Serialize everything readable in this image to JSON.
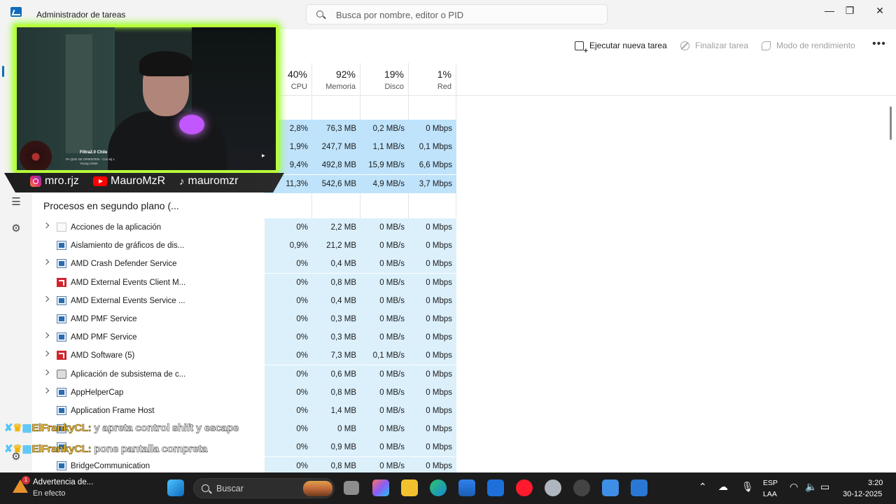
{
  "window": {
    "title": "Administrador de tareas",
    "search_placeholder": "Busca por nombre, editor o PID",
    "minimize": "—",
    "maximize": "❐",
    "close": "✕"
  },
  "commands": {
    "run_task": "Ejecutar nueva tarea",
    "end_task": "Finalizar tarea",
    "efficiency_mode": "Modo de rendimiento",
    "more": "•••"
  },
  "columns": [
    {
      "percent": "40%",
      "label": "CPU"
    },
    {
      "percent": "92%",
      "label": "Memoria"
    },
    {
      "percent": "19%",
      "label": "Disco"
    },
    {
      "percent": "1%",
      "label": "Red"
    }
  ],
  "apps_rows": [
    {
      "cpu": "2,8%",
      "mem": "76,3 MB",
      "disk": "0,2 MB/s",
      "net": "0 Mbps"
    },
    {
      "cpu": "1,9%",
      "mem": "247,7 MB",
      "disk": "1,1 MB/s",
      "net": "0,1 Mbps"
    },
    {
      "cpu": "9,4%",
      "mem": "492,8 MB",
      "disk": "15,9 MB/s",
      "net": "6,6 Mbps"
    },
    {
      "cpu": "11,3%",
      "mem": "542,6 MB",
      "disk": "4,9 MB/s",
      "net": "3,7 Mbps"
    }
  ],
  "background_group": {
    "title": "Procesos en segundo plano (..."
  },
  "background_rows": [
    {
      "name": "Acciones de la aplicación",
      "icon": "blank-icon",
      "expand": true,
      "cpu": "0%",
      "mem": "2,2 MB",
      "disk": "0 MB/s",
      "net": "0 Mbps"
    },
    {
      "name": "Aislamiento de gráficos de dis...",
      "icon": "window-icon",
      "expand": false,
      "cpu": "0,9%",
      "mem": "21,2 MB",
      "disk": "0 MB/s",
      "net": "0 Mbps"
    },
    {
      "name": "AMD Crash Defender Service",
      "icon": "window-icon",
      "expand": true,
      "cpu": "0%",
      "mem": "0,4 MB",
      "disk": "0 MB/s",
      "net": "0 Mbps"
    },
    {
      "name": "AMD External Events Client M...",
      "icon": "amd-icon",
      "expand": false,
      "cpu": "0%",
      "mem": "0,8 MB",
      "disk": "0 MB/s",
      "net": "0 Mbps"
    },
    {
      "name": "AMD External Events Service ...",
      "icon": "window-icon",
      "expand": true,
      "cpu": "0%",
      "mem": "0,4 MB",
      "disk": "0 MB/s",
      "net": "0 Mbps"
    },
    {
      "name": "AMD PMF Service",
      "icon": "window-icon",
      "expand": false,
      "cpu": "0%",
      "mem": "0,3 MB",
      "disk": "0 MB/s",
      "net": "0 Mbps"
    },
    {
      "name": "AMD PMF Service",
      "icon": "window-icon",
      "expand": true,
      "cpu": "0%",
      "mem": "0,3 MB",
      "disk": "0 MB/s",
      "net": "0 Mbps"
    },
    {
      "name": "AMD Software (5)",
      "icon": "amd-icon",
      "expand": true,
      "cpu": "0%",
      "mem": "7,3 MB",
      "disk": "0,1 MB/s",
      "net": "0 Mbps"
    },
    {
      "name": "Aplicación de subsistema de c...",
      "icon": "printer-icon",
      "expand": true,
      "cpu": "0%",
      "mem": "0,6 MB",
      "disk": "0 MB/s",
      "net": "0 Mbps"
    },
    {
      "name": "AppHelperCap",
      "icon": "window-icon",
      "expand": true,
      "cpu": "0%",
      "mem": "0,8 MB",
      "disk": "0 MB/s",
      "net": "0 Mbps"
    },
    {
      "name": "Application Frame Host",
      "icon": "window-icon",
      "expand": false,
      "cpu": "0%",
      "mem": "1,4 MB",
      "disk": "0 MB/s",
      "net": "0 Mbps"
    },
    {
      "name": "",
      "icon": "window-icon",
      "expand": false,
      "cpu": "0%",
      "mem": "0 MB",
      "disk": "0 MB/s",
      "net": "0 Mbps"
    },
    {
      "name": "",
      "icon": "window-icon",
      "expand": false,
      "cpu": "0%",
      "mem": "0,9 MB",
      "disk": "0 MB/s",
      "net": "0 Mbps"
    },
    {
      "name": "BridgeCommunication",
      "icon": "window-icon",
      "expand": false,
      "cpu": "0%",
      "mem": "0,8 MB",
      "disk": "0 MB/s",
      "net": "0 Mbps"
    }
  ],
  "stream_overlay": {
    "song_title": "Filtra2.0 Chile",
    "song_line2": "PA QUE SE ORIENTEN - Cris Mj x",
    "song_line3": "Young Cister",
    "instagram": "mro.rjz",
    "youtube": "MauroMzR",
    "tiktok": "mauromzr"
  },
  "chat": [
    {
      "user": "ElFrankyCL:",
      "message": " y apreta control shift y escape"
    },
    {
      "user": "ElFrankyCL:",
      "message": " pone pantalla compreta"
    }
  ],
  "taskbar": {
    "widget_title": "Advertencia de...",
    "widget_sub": "En efecto",
    "alert_badge": "1",
    "search_label": "Buscar",
    "lang_top": "ESP",
    "lang_bottom": "LAA",
    "time": "3:20",
    "date": "30-12-2025"
  },
  "colors": {
    "accent": "#0f6cbd",
    "heat_high": "#bfe3fb",
    "heat_low": "#dcf0fc",
    "webcam_border": "#b8ff3b"
  }
}
